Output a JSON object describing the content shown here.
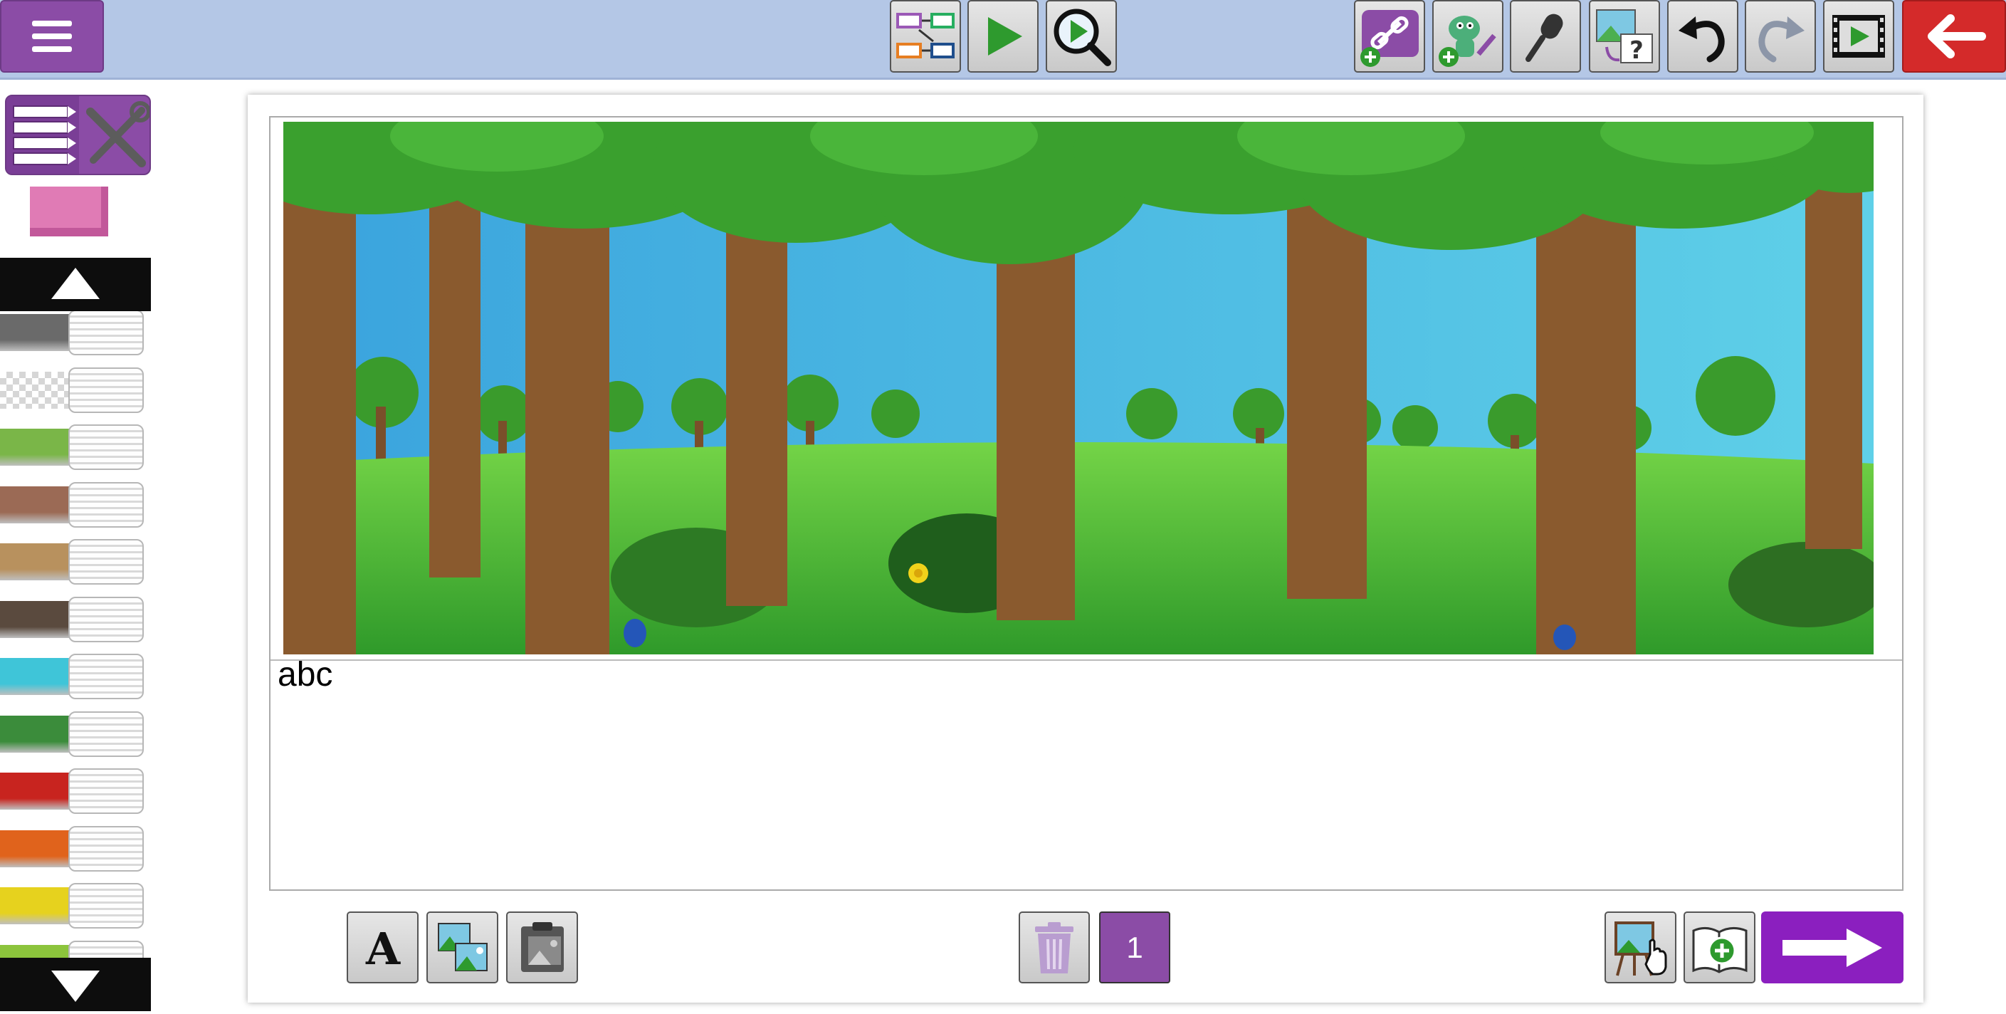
{
  "page": {
    "text": "abc",
    "number": "1"
  },
  "toolbar": {
    "center": [
      "storyboard-icon",
      "play-icon",
      "preview-icon"
    ],
    "right": [
      "link-add-icon",
      "character-add-icon",
      "microphone-icon",
      "image-question-icon",
      "undo-icon",
      "redo-icon",
      "movie-play-icon",
      "back-arrow-icon"
    ]
  },
  "sidebar": {
    "markers": [
      {
        "name": "gray",
        "color": "#6a6a6a"
      },
      {
        "name": "transparent",
        "color": "checker"
      },
      {
        "name": "green-scales",
        "color": "#7ab648"
      },
      {
        "name": "brick",
        "color": "#9b6a55"
      },
      {
        "name": "wood-light",
        "color": "#b8915e"
      },
      {
        "name": "bark",
        "color": "#5a4a3e"
      },
      {
        "name": "water",
        "color": "#3fc5d8"
      },
      {
        "name": "grass",
        "color": "#3b8c3b"
      },
      {
        "name": "red",
        "color": "#c8241f"
      },
      {
        "name": "orange",
        "color": "#e0631c"
      },
      {
        "name": "yellow",
        "color": "#e6d21e"
      },
      {
        "name": "lime",
        "color": "#8cc43c"
      }
    ]
  },
  "colors": {
    "topbar": "#b4c7e6",
    "accent": "#8b4ca6",
    "back": "#d42a2a"
  }
}
